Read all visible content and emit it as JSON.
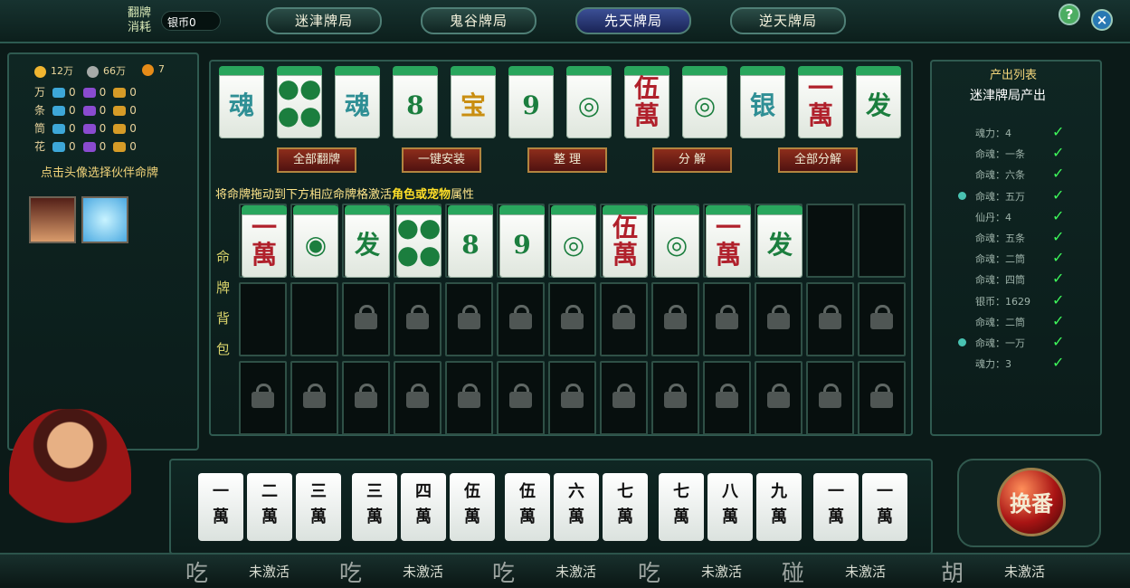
{
  "top": {
    "cost_label": "翻牌\n消耗",
    "silver": "银币0",
    "tabs": [
      "迷津牌局",
      "鬼谷牌局",
      "先天牌局",
      "逆天牌局"
    ],
    "active_tab": 2
  },
  "resources": {
    "gold": "12万",
    "silver": "66万",
    "spiral": "7",
    "rows": [
      [
        "万",
        "0",
        "0",
        "0"
      ],
      [
        "条",
        "0",
        "0",
        "0"
      ],
      [
        "筒",
        "0",
        "0",
        "0"
      ],
      [
        "花",
        "0",
        "0",
        "0"
      ]
    ]
  },
  "partner_prompt": "点击头像选择伙伴命牌",
  "main_tiles": [
    {
      "label": "魂",
      "type": "cyan"
    },
    {
      "label": "●●\n●●",
      "type": "green"
    },
    {
      "label": "魂",
      "type": "cyan"
    },
    {
      "label": "8",
      "type": "green"
    },
    {
      "label": "宝",
      "type": "gold"
    },
    {
      "label": "9",
      "type": "green"
    },
    {
      "label": "◎",
      "type": "green"
    },
    {
      "label": "伍\n萬",
      "type": "red"
    },
    {
      "label": "◎",
      "type": "green"
    },
    {
      "label": "银",
      "type": "cyan"
    },
    {
      "label": "一\n萬",
      "type": "red"
    },
    {
      "label": "发",
      "type": "green"
    }
  ],
  "buttons": [
    "全部翻牌",
    "一键安装",
    "整 理",
    "分 解",
    "全部分解"
  ],
  "drag_hint_prefix": "将命牌拖动到下方相应命牌格激活",
  "drag_hint_highlight": "角色或宠物",
  "drag_hint_suffix": "属性",
  "bag_label": [
    "命",
    "牌",
    "背",
    "包"
  ],
  "bag_tiles": [
    {
      "label": "一\n萬",
      "type": "red"
    },
    {
      "label": "◉",
      "type": "green"
    },
    {
      "label": "发",
      "type": "green"
    },
    {
      "label": "●●\n●●",
      "type": "green"
    },
    {
      "label": "8",
      "type": "green"
    },
    {
      "label": "9",
      "type": "green"
    },
    {
      "label": "◎",
      "type": "green"
    },
    {
      "label": "伍\n萬",
      "type": "red"
    },
    {
      "label": "◎",
      "type": "green"
    },
    {
      "label": "一\n萬",
      "type": "red"
    },
    {
      "label": "发",
      "type": "green"
    }
  ],
  "output": {
    "title": "产出列表",
    "subtitle": "迷津牌局产出",
    "items": [
      {
        "text": "魂力：4",
        "mark": false
      },
      {
        "text": "命魂：一条",
        "mark": false
      },
      {
        "text": "命魂：六条",
        "mark": false
      },
      {
        "text": "命魂：五万",
        "mark": true
      },
      {
        "text": "仙丹：4",
        "mark": false
      },
      {
        "text": "命魂：五条",
        "mark": false
      },
      {
        "text": "命魂：二筒",
        "mark": false
      },
      {
        "text": "命魂：四筒",
        "mark": false
      },
      {
        "text": "银币：1629",
        "mark": false
      },
      {
        "text": "命魂：二筒",
        "mark": false
      },
      {
        "text": "命魂：一万",
        "mark": true
      },
      {
        "text": "魂力：3",
        "mark": false
      }
    ]
  },
  "hand": [
    "一\n萬",
    "二\n萬",
    "三\n萬",
    "三\n萬",
    "四\n萬",
    "伍\n萬",
    "伍\n萬",
    "六\n萬",
    "七\n萬",
    "七\n萬",
    "八\n萬",
    "九\n萬",
    "一\n萬",
    "一\n萬"
  ],
  "exchange_label": "换番",
  "actions": [
    {
      "name": "吃",
      "status": "未激活"
    },
    {
      "name": "吃",
      "status": "未激活"
    },
    {
      "name": "吃",
      "status": "未激活"
    },
    {
      "name": "吃",
      "status": "未激活"
    },
    {
      "name": "碰",
      "status": "未激活"
    },
    {
      "name": "胡",
      "status": "未激活"
    }
  ]
}
